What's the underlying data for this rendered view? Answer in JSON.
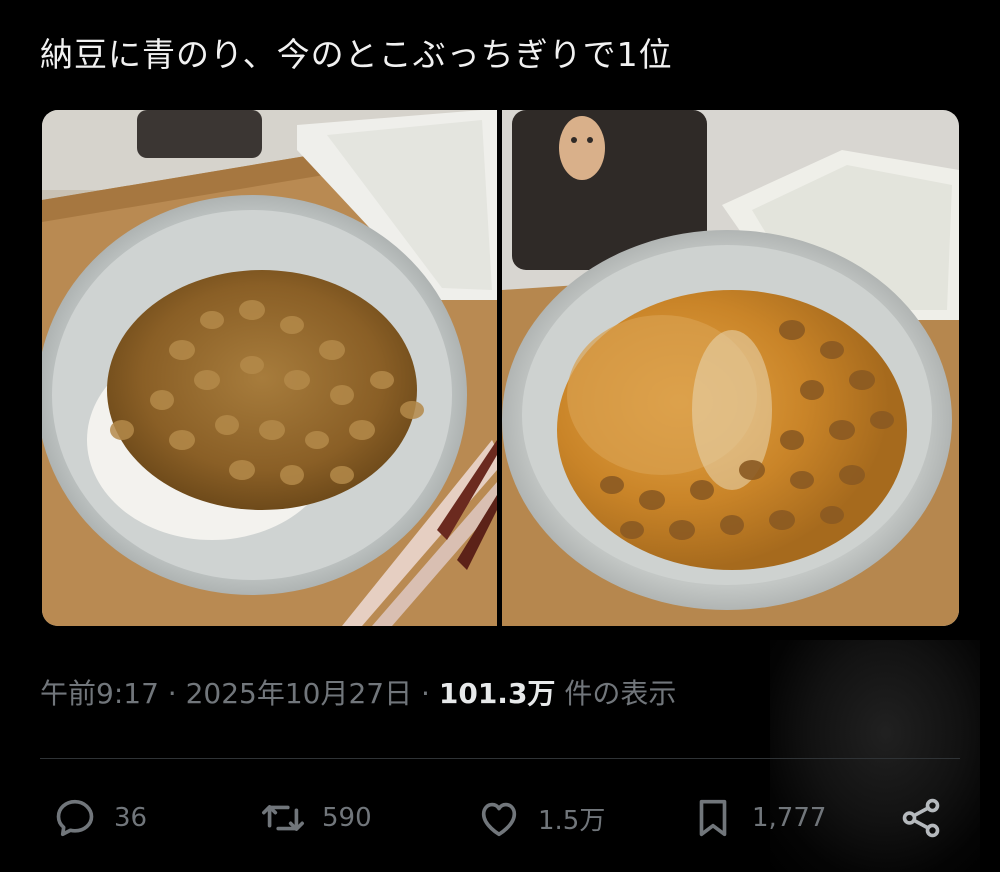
{
  "tweet": {
    "text": "納豆に青のり、今のとこぶっちぎりで1位"
  },
  "meta": {
    "time": "午前9:17",
    "date": "2025年10月27日",
    "views_count": "101.3万",
    "views_label": "件の表示"
  },
  "actions": {
    "replies": "36",
    "retweets": "590",
    "likes": "1.5万",
    "bookmarks": "1,777"
  },
  "icons": {
    "reply": "reply-icon",
    "retweet": "retweet-icon",
    "like": "heart-icon",
    "bookmark": "bookmark-icon",
    "share": "share-icon"
  },
  "colors": {
    "background": "#000000",
    "text": "#e7e9ea",
    "muted": "#71767b",
    "divider": "#2f3336"
  }
}
